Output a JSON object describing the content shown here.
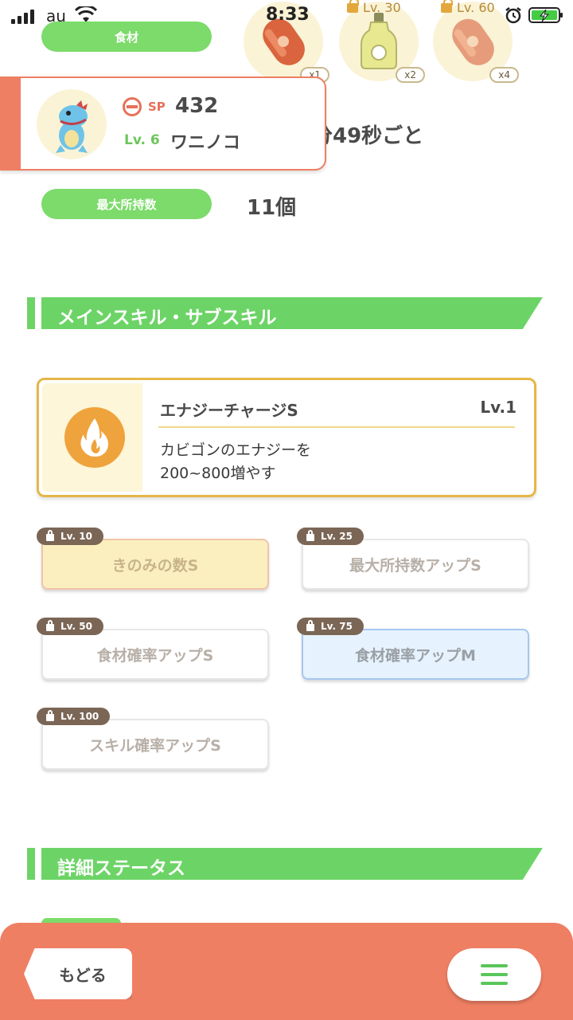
{
  "status": {
    "carrier": "au",
    "time": "8:33"
  },
  "ingredients_label": "食材",
  "ingredients": [
    {
      "name": "sausage-icon",
      "count": "x1",
      "lock": ""
    },
    {
      "name": "oil-bottle-icon",
      "count": "x2",
      "lock": "Lv. 30"
    },
    {
      "name": "sausage-icon",
      "count": "x4",
      "lock": "Lv. 60"
    }
  ],
  "pokemon": {
    "sp_label": "SP",
    "sp": "432",
    "level": "Lv. 6",
    "name": "ワニノコ"
  },
  "help_interval_partial": "分49秒ごと",
  "max_carry": {
    "label": "最大所持数",
    "value": "11個"
  },
  "skills_section": {
    "title": "メインスキル・サブスキル"
  },
  "main_skill": {
    "name": "エナジーチャージS",
    "level": "Lv.1",
    "description_1": "カビゴンのエナジーを",
    "description_2": "200~800増やす"
  },
  "sub_skills": [
    {
      "lv": "Lv. 10",
      "name": "きのみの数S"
    },
    {
      "lv": "Lv. 25",
      "name": "最大所持数アップS"
    },
    {
      "lv": "Lv. 50",
      "name": "食材確率アップS"
    },
    {
      "lv": "Lv. 75",
      "name": "食材確率アップM"
    },
    {
      "lv": "Lv. 100",
      "name": "スキル確率アップS"
    }
  ],
  "detail_section": {
    "title": "詳細ステータス"
  },
  "nav": {
    "back": "もどる"
  },
  "colors": {
    "accent_green": "#6cd466",
    "bottom_bar": "#ef7f63",
    "gold_border": "#e6b748"
  }
}
